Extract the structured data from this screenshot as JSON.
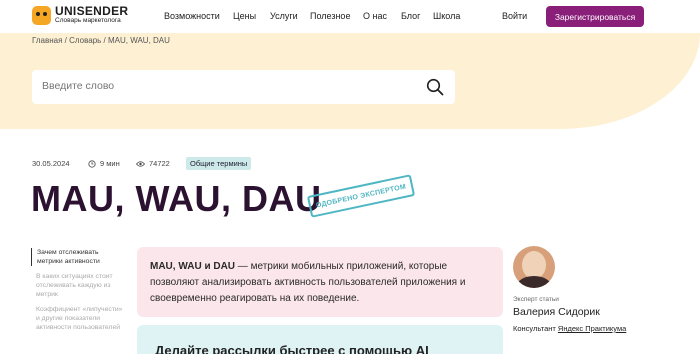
{
  "header": {
    "logo_title": "UNISENDER",
    "logo_subtitle": "Словарь маркетолога",
    "nav": [
      "Возможности",
      "Цены",
      "Услуги",
      "Полезное",
      "О нас",
      "Блог",
      "Школа"
    ],
    "login_label": "Войти",
    "register_label": "Зарегистрироваться"
  },
  "breadcrumb": "Главная / Словарь / MAU, WAU, DAU",
  "search": {
    "placeholder": "Введите слово"
  },
  "meta": {
    "date": "30.05.2024",
    "read_time": "9 мин",
    "views": "74722",
    "tag": "Общие термины"
  },
  "article": {
    "title": "MAU, WAU, DAU",
    "stamp": "одобрено экспертом",
    "lead_bold": "MAU, WAU и DAU",
    "lead_text": " — метрики мобильных приложений, которые позволяют анализировать активность пользователей приложения и своевременно реагировать на их поведение.",
    "promo": "Делайте рассылки быстрее с помощью AI"
  },
  "toc": [
    "Зачем отслеживать метрики активности",
    "В каких ситуациях стоит отслеживать каждую из метрик",
    "Коэффициент «липучести» и другие показатели активности пользователей"
  ],
  "expert": {
    "label": "Эксперт статьи",
    "name": "Валерия Сидорик",
    "role_prefix": "Консультант ",
    "role_link": "Яндекс Практикума"
  },
  "colors": {
    "brand": "#8a1f7a",
    "hero_bg": "#fdf0d3",
    "lead_bg": "#fbe6ec",
    "promo_bg": "#dff3f4",
    "stamp": "#4fb7c3"
  },
  "icons": {
    "logo": "unisender-dog-icon",
    "search": "search-icon",
    "clock": "clock-icon",
    "eye": "eye-icon"
  }
}
